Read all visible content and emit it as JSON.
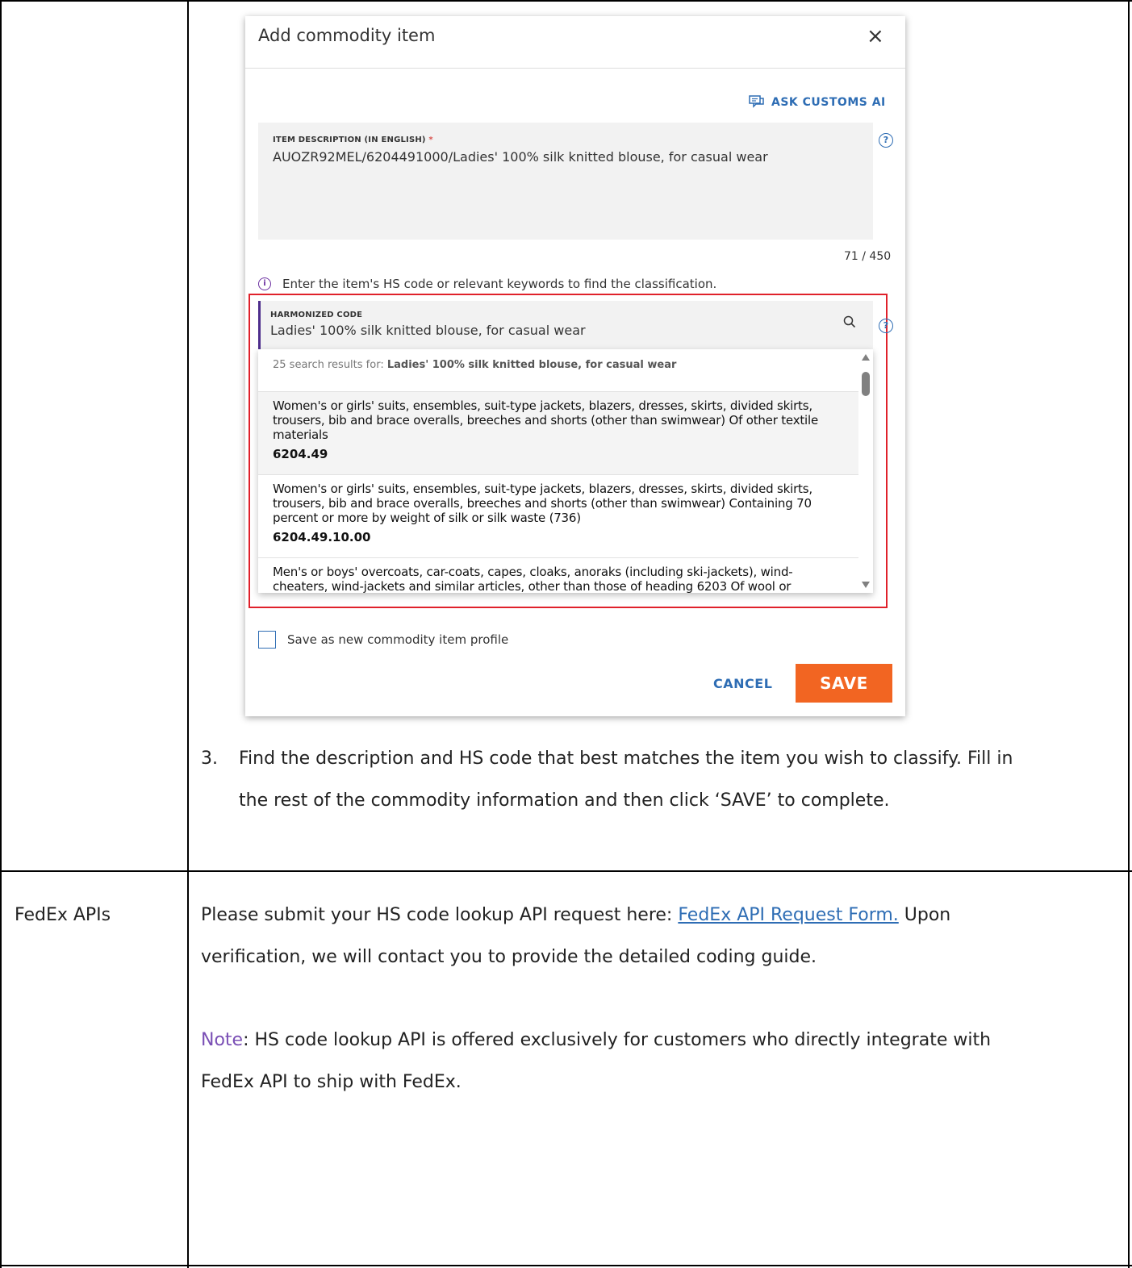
{
  "dialog": {
    "title": "Add commodity item",
    "close_symbol": "×",
    "ask_ai_label": "ASK CUSTOMS AI",
    "item_description": {
      "label": "ITEM DESCRIPTION (IN ENGLISH)",
      "required_mark": "*",
      "value": "AUOZR92MEL/6204491000/Ladies' 100% silk knitted blouse, for casual wear"
    },
    "char_counter": "71 / 450",
    "info_text": "Enter the item's HS code or relevant keywords to find the classification.",
    "harmonized": {
      "label": "HARMONIZED CODE",
      "value": "Ladies' 100% silk knitted blouse, for casual wear"
    },
    "results_header_prefix": "25 search results for:",
    "results_header_query": "Ladies' 100% silk knitted blouse, for casual wear",
    "results": [
      {
        "description": "Women's or girls' suits, ensembles, suit-type jackets, blazers, dresses, skirts, divided skirts, trousers, bib and brace overalls, breeches and shorts (other than swimwear) Of other textile materials",
        "code": "6204.49"
      },
      {
        "description": "Women's or girls' suits, ensembles, suit-type jackets, blazers, dresses, skirts, divided skirts, trousers, bib and brace overalls, breeches and shorts (other than swimwear) Containing 70 percent or more by weight of silk or silk waste (736)",
        "code": "6204.49.10.00"
      },
      {
        "description": "Men's or boys' overcoats, car-coats, capes, cloaks, anoraks (including ski-jackets), wind-cheaters, wind-jackets and similar articles, other than those of heading 6203 Of wool or",
        "code": ""
      }
    ],
    "save_profile_label": "Save as new commodity item profile",
    "cancel_label": "CANCEL",
    "save_label": "SAVE"
  },
  "step": {
    "number": "3.",
    "line1": "Find the description and HS code that best matches the item you wish to classify. Fill in",
    "line2": "the rest of the commodity information and then click ‘SAVE’ to complete."
  },
  "row_fedex": {
    "label": "FedEx APIs",
    "para_prefix": "Please submit your HS code lookup API request here:",
    "link_text": "FedEx API Request Form.",
    "para_suffix": "Upon",
    "para_line2": "verification, we will contact you to provide the detailed coding guide.",
    "note_label": "Note",
    "note_line1": ": HS code lookup API is offered exclusively for customers who directly integrate with",
    "note_line2": "FedEx API to ship with FedEx."
  }
}
